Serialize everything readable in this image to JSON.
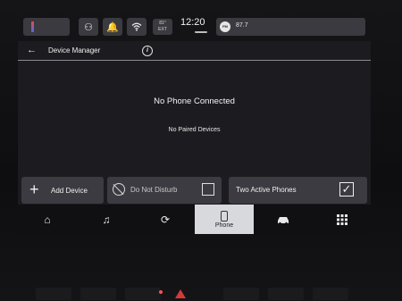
{
  "status_bar": {
    "clock": "12:20",
    "temperature": "81°",
    "temperature_label": "EXT",
    "radio_band": "FM",
    "radio_station": "87.7",
    "icons": [
      "driver-profile-icon",
      "notification-bell-icon",
      "wifi-icon"
    ]
  },
  "header": {
    "back_glyph": "←",
    "title": "Device Manager",
    "info_glyph": "i"
  },
  "content": {
    "primary_message": "No Phone Connected",
    "secondary_message": "No Paired Devices"
  },
  "actions": {
    "add_device_label": "Add Device",
    "do_not_disturb_label": "Do Not Disturb",
    "do_not_disturb_checked": false,
    "two_active_phones_label": "Two Active Phones",
    "two_active_phones_checked": true
  },
  "nav": {
    "items": [
      {
        "icon": "home-icon",
        "glyph": "⌂",
        "label": ""
      },
      {
        "icon": "music-icon",
        "glyph": "♫",
        "label": ""
      },
      {
        "icon": "navigation-icon",
        "glyph": "⟳",
        "label": ""
      },
      {
        "icon": "phone-icon",
        "glyph": "",
        "label": "Phone",
        "active": true
      },
      {
        "icon": "car-icon",
        "glyph": "🚘",
        "label": ""
      },
      {
        "icon": "apps-grid-icon",
        "glyph": "⊞",
        "label": ""
      }
    ]
  },
  "colors": {
    "screen_bg": "#1c1c20",
    "button_bg": "#3b3b41",
    "active_tab_bg": "#d7d9dd"
  }
}
